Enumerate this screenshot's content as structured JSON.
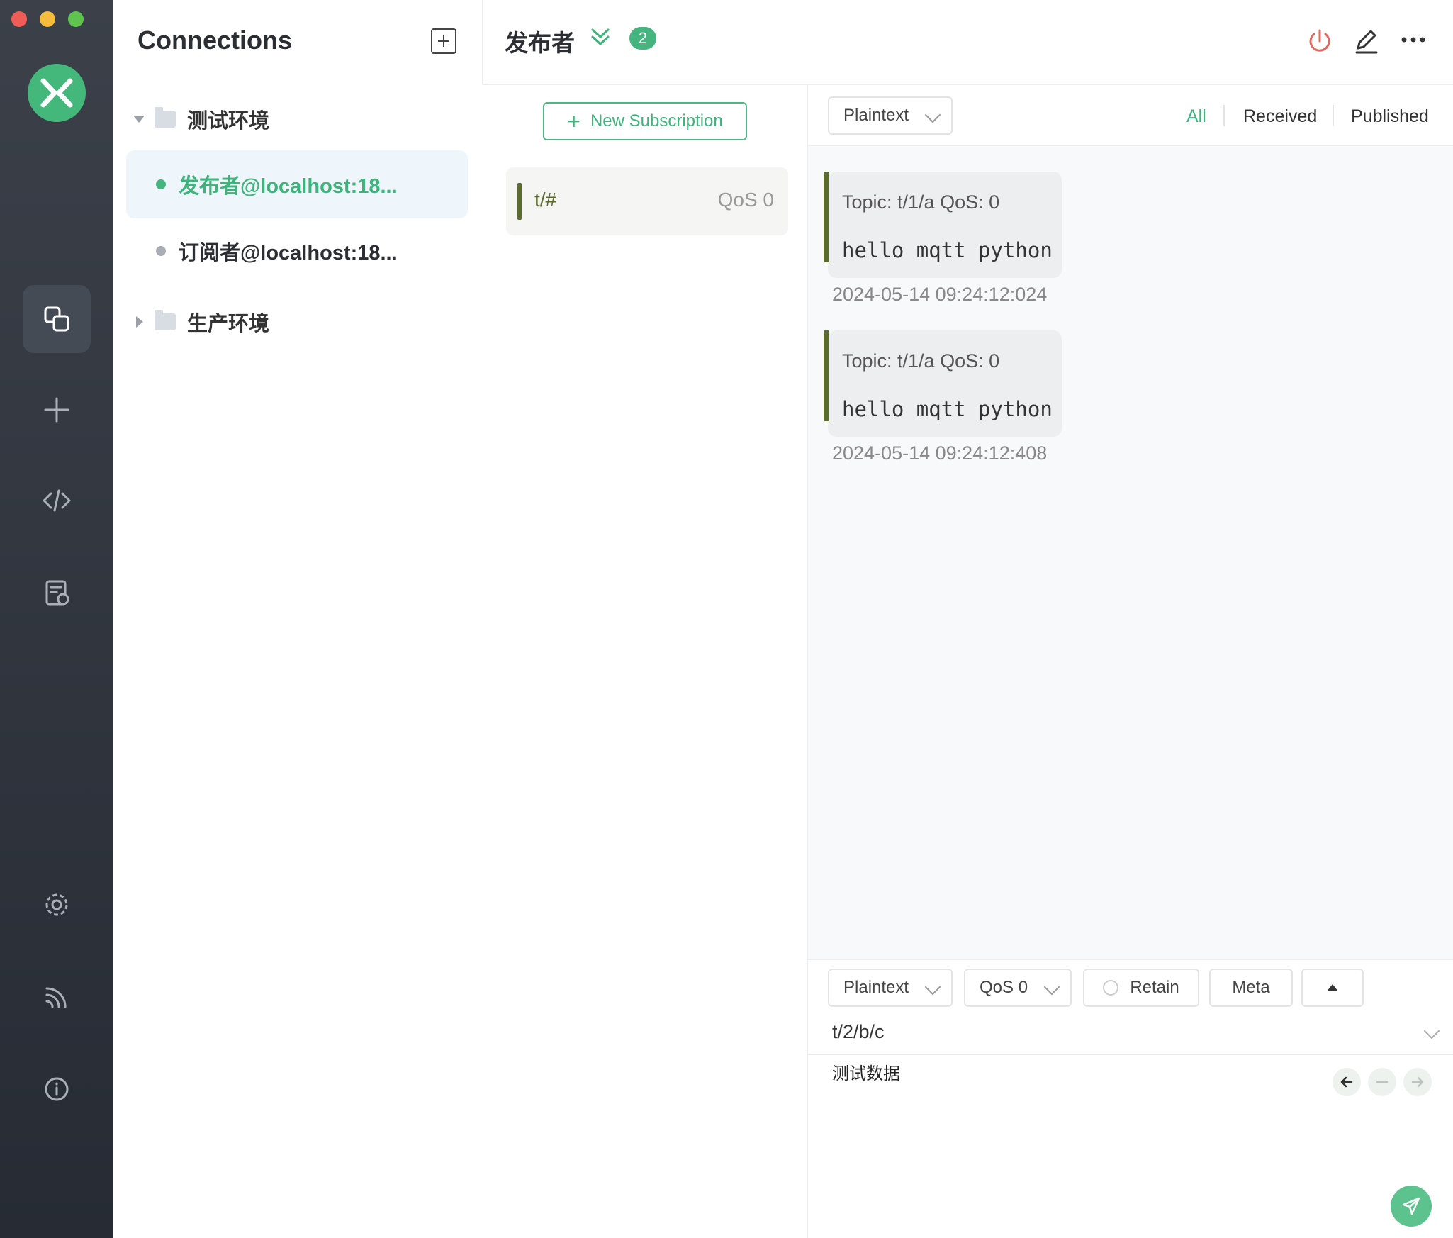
{
  "app": {
    "icons": {
      "logo": "mqttx-logo-icon",
      "connections": "connections-icon",
      "new": "plus-icon",
      "script": "code-icon",
      "log": "log-icon",
      "settings": "gear-icon",
      "feed": "feed-icon",
      "about": "info-icon"
    },
    "accent_color": "#3fb37c"
  },
  "connections": {
    "title": "Connections",
    "groups": [
      {
        "name": "测试环境",
        "expanded": true,
        "items": [
          {
            "label": "发布者@localhost:18...",
            "status": "connected",
            "dot_color": "#45b47f",
            "selected": true
          },
          {
            "label": "订阅者@localhost:18...",
            "status": "disconnected",
            "dot_color": "#a9adb4",
            "selected": false
          }
        ]
      },
      {
        "name": "生产环境",
        "expanded": false,
        "items": []
      }
    ]
  },
  "header": {
    "title": "发布者",
    "badge_count": "2"
  },
  "subscriptions": {
    "new_button": "New Subscription",
    "items": [
      {
        "topic": "t/#",
        "qos": "QoS 0",
        "color": "#5b6a2e"
      }
    ]
  },
  "messages": {
    "format": "Plaintext",
    "filters": [
      "All",
      "Received",
      "Published"
    ],
    "active_filter": "All",
    "items": [
      {
        "meta": "Topic: t/1/a   QoS: 0",
        "payload": "hello mqtt python",
        "time": "2024-05-14 09:24:12:024"
      },
      {
        "meta": "Topic: t/1/a   QoS: 0",
        "payload": "hello mqtt python",
        "time": "2024-05-14 09:24:12:408"
      }
    ]
  },
  "publish": {
    "format": "Plaintext",
    "qos": "QoS 0",
    "retain": "Retain",
    "meta": "Meta",
    "topic": "t/2/b/c",
    "payload": "测试数据"
  }
}
